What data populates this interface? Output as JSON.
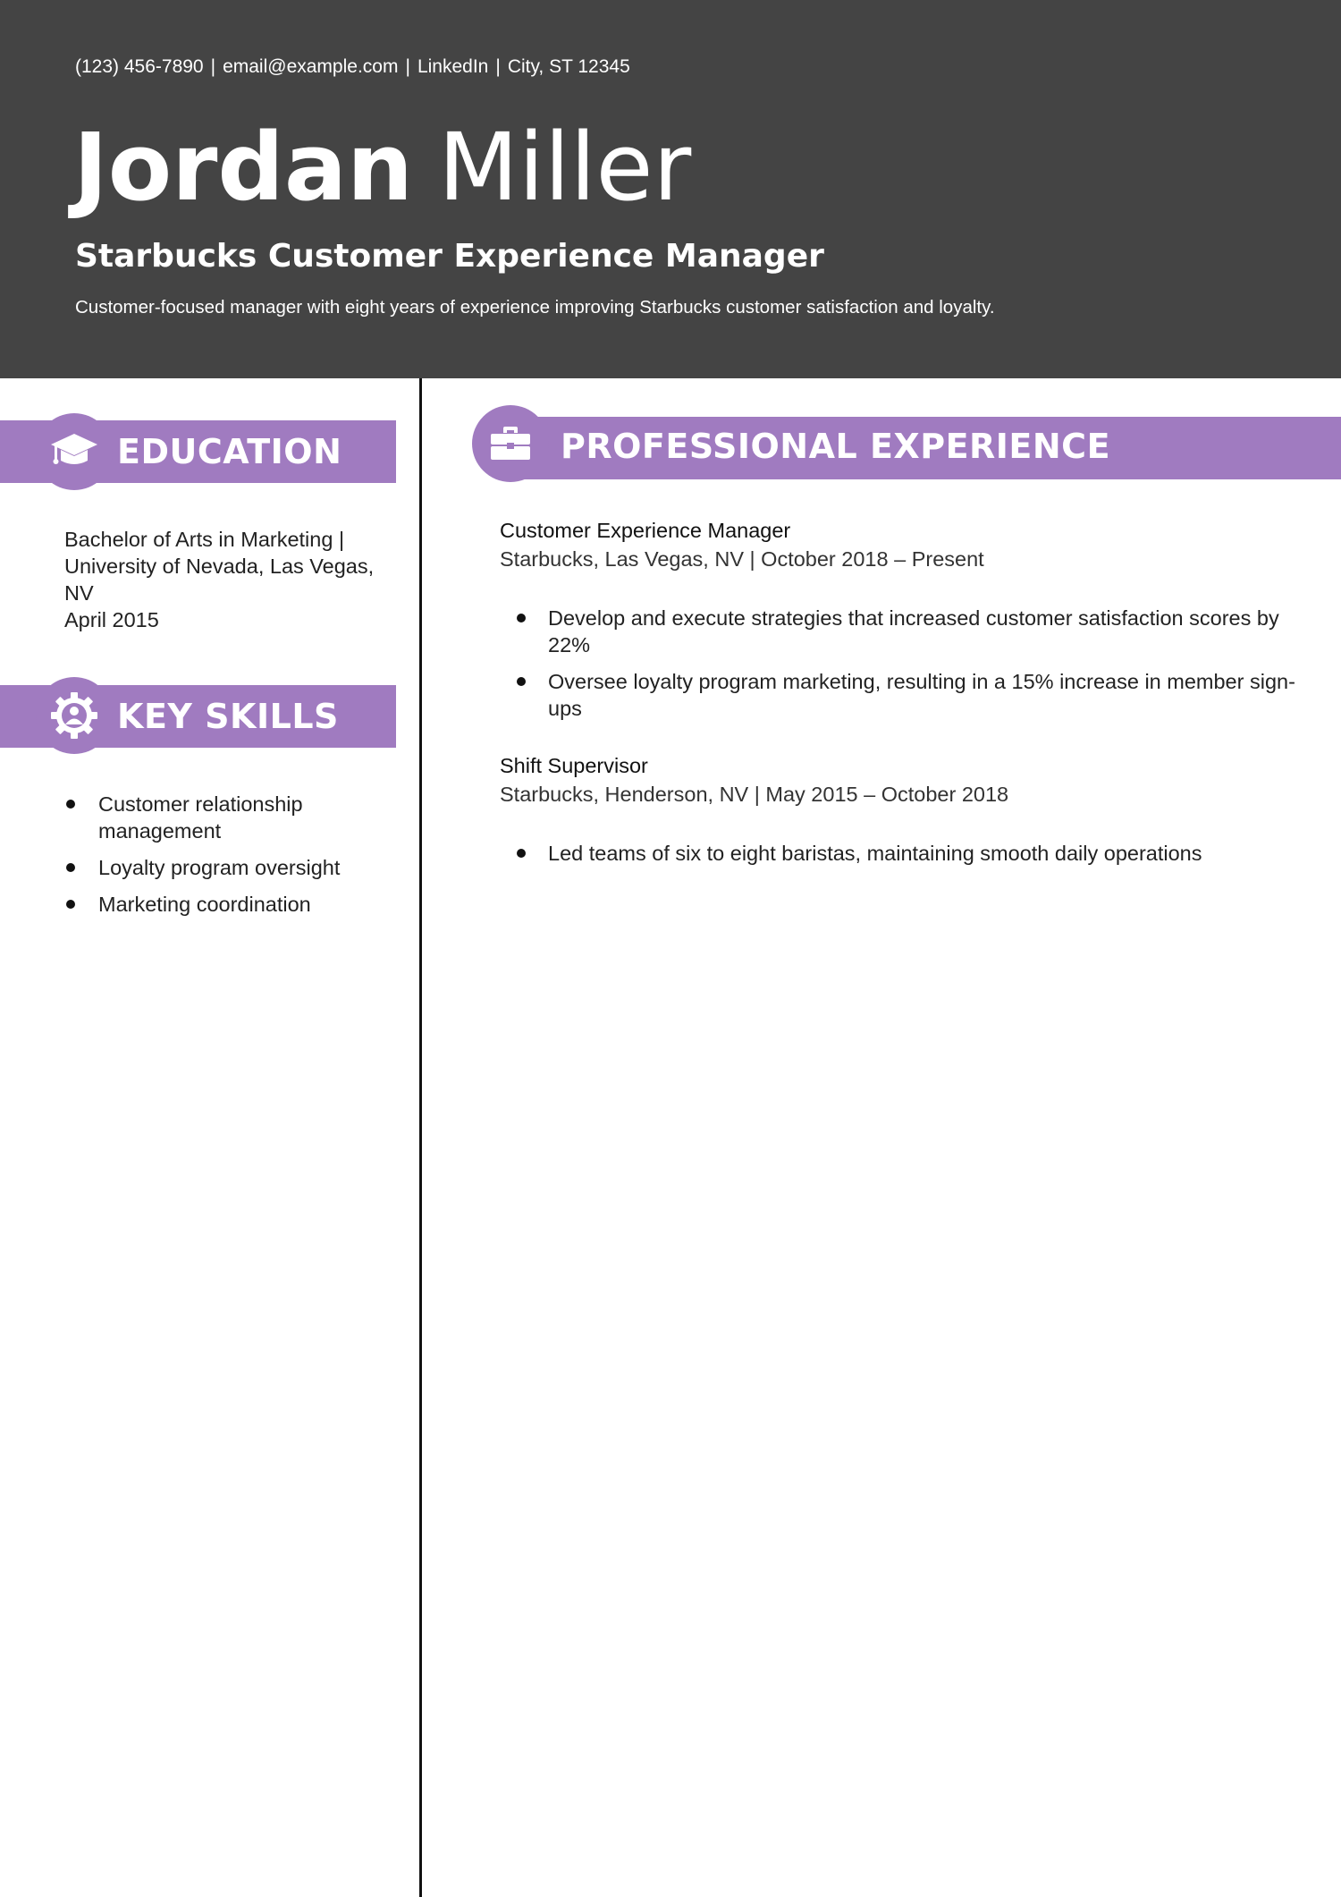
{
  "header": {
    "contact": [
      "(123) 456-7890",
      "email@example.com",
      "LinkedIn",
      "City, ST 12345"
    ],
    "contact_separator": "|",
    "first_name": "Jordan",
    "last_name": "Miller",
    "title": "Starbucks Customer Experience Manager",
    "summary": "Customer-focused manager with eight years of experience improving Starbucks customer satisfaction and loyalty."
  },
  "education": {
    "heading": "EDUCATION",
    "icon": "graduation-cap-icon",
    "degree_line1": "Bachelor of Arts in Marketing |",
    "degree_line2": "University of Nevada, Las Vegas,",
    "degree_line3": "NV",
    "date": "April 2015"
  },
  "skills": {
    "heading": "KEY SKILLS",
    "icon": "gear-person-icon",
    "items": [
      "Customer relationship management",
      "Loyalty program oversight",
      "Marketing coordination"
    ]
  },
  "experience": {
    "heading": "PROFESSIONAL EXPERIENCE",
    "icon": "briefcase-icon",
    "jobs": [
      {
        "title": "Customer Experience Manager",
        "meta": "Starbucks, Las Vegas, NV | October 2018 – Present",
        "bullets": [
          "Develop and execute strategies that increased customer satisfaction scores by 22%",
          "Oversee loyalty program marketing, resulting in a 15% increase in member sign-ups"
        ]
      },
      {
        "title": "Shift Supervisor",
        "meta": "Starbucks, Henderson, NV | May 2015 – October 2018",
        "bullets": [
          "Led teams of six to eight baristas, maintaining smooth daily operations"
        ]
      }
    ]
  },
  "colors": {
    "header_bg": "#444444",
    "accent": "#a07bc0",
    "divider": "#111111"
  }
}
